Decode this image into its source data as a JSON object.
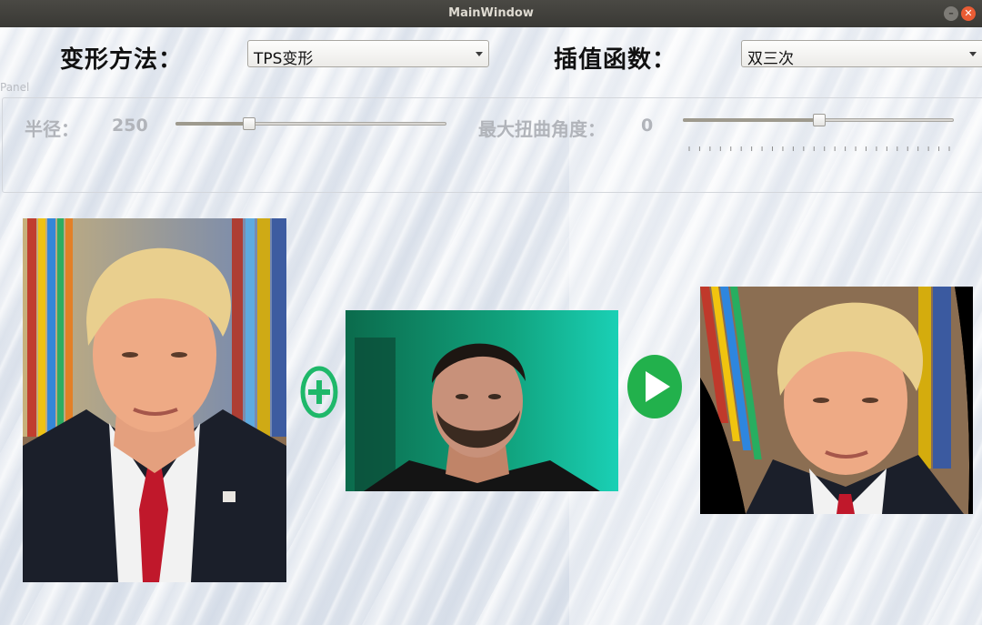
{
  "window": {
    "title": "MainWindow"
  },
  "controls": {
    "warp_label": "变形方法：",
    "warp_value": "TPS变形",
    "interp_label": "插值函数：",
    "interp_value": "双三次"
  },
  "panel": {
    "title": "Panel",
    "radius_label": "半径：",
    "radius_value": "250",
    "radius_slider_fraction": 0.26,
    "distort_label": "最大扭曲角度：",
    "distort_value": "0",
    "distort_slider_fraction": 0.5
  },
  "images": {
    "source_person": "suit-portrait-man",
    "target_person": "bearded-man-portrait",
    "result_person": "warped-suit-portrait"
  },
  "colors": {
    "add_icon": "#1fb86a",
    "play_icon": "#22b14c"
  },
  "icons": {
    "add": "plus-circle-icon",
    "run": "play-icon"
  }
}
